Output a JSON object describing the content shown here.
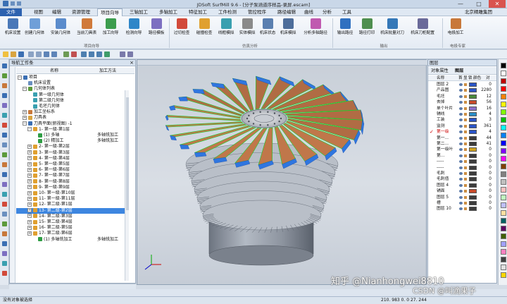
{
  "window": {
    "title": "JDSoft SurfMill 9.6 - [分子泵涵道序样品-录屏.escam]",
    "min": "—",
    "restore": "□",
    "close": "✕"
  },
  "menu": {
    "items": [
      "文件",
      "视图",
      "编辑",
      "资源管理",
      "项目向导",
      "三轴加工",
      "多轴加工",
      "特征加工",
      "工件检测",
      "管控程序",
      "路径编辑",
      "曲线",
      "分析",
      "工具"
    ],
    "right": "北京精雕集团"
  },
  "ribbon": {
    "buttons": [
      "机床设置",
      "创建几何体",
      "安装几何体",
      "当前刀具表",
      "加工向导",
      "检测向导",
      "路径模板",
      "过切检查",
      "碰撞检查",
      "线框模拟",
      "实体模拟",
      "机床状态",
      "机床模拟",
      "分析多轴路径",
      "输出路径",
      "路径打印",
      "机床批量对刀",
      "机床刀柜配置",
      "电极加工"
    ],
    "groups": [
      "项目向导",
      "仿真分析",
      "输出",
      "电极专家"
    ]
  },
  "nav_panel": {
    "title": "导航工作条",
    "columns": [
      "名称",
      "加工方法"
    ],
    "rows": [
      {
        "label": "项目",
        "method": ""
      },
      {
        "label": "机床设置",
        "method": ""
      },
      {
        "label": "几何体列表",
        "method": ""
      },
      {
        "label": "第一级几何体",
        "method": ""
      },
      {
        "label": "第二级几何体",
        "method": ""
      },
      {
        "label": "毛坯几何体",
        "method": ""
      },
      {
        "label": "加工坐标系",
        "method": ""
      },
      {
        "label": "刀具表",
        "method": ""
      },
      {
        "label": "刀具平面(俯视图) -1",
        "method": ""
      },
      {
        "label": "1- 第一级-第1层",
        "method": ""
      },
      {
        "label": "(1) 多轴",
        "method": "多轴铣加工"
      },
      {
        "label": "(2) 精加工",
        "method": "多轴铣加工"
      },
      {
        "label": "2- 第一级-第2层",
        "method": ""
      },
      {
        "label": "3- 第一级-第3层",
        "method": ""
      },
      {
        "label": "4- 第一级-第4层",
        "method": ""
      },
      {
        "label": "5- 第一级-第5层",
        "method": ""
      },
      {
        "label": "6- 第一级-第6层",
        "method": ""
      },
      {
        "label": "7- 第一级-第7层",
        "method": ""
      },
      {
        "label": "8- 第一级-第8层",
        "method": ""
      },
      {
        "label": "9- 第一级-第9层",
        "method": ""
      },
      {
        "label": "10- 第一级-第10层",
        "method": ""
      },
      {
        "label": "11- 第一级-第11层",
        "method": ""
      },
      {
        "label": "12- 第二级-第1层",
        "method": ""
      },
      {
        "label": "13- 第二级-第2层",
        "method": ""
      },
      {
        "label": "14- 第二级-第3层",
        "method": ""
      },
      {
        "label": "15- 第二级-第4层",
        "method": ""
      },
      {
        "label": "16- 第二级-第5层",
        "method": ""
      },
      {
        "label": "17- 第二级-第6层",
        "method": ""
      },
      {
        "label": "(1) 多轴铣加工",
        "method": "多轴铣加工"
      }
    ],
    "selected_index": 23
  },
  "layers_panel": {
    "title": "图层",
    "tabs": [
      "对象属性",
      "图层"
    ],
    "header": [
      "名称",
      "首",
      "显",
      "锁",
      "颜色",
      "对"
    ],
    "rows": [
      {
        "name": "图层 2",
        "count": "0",
        "color": "#2b55c8",
        "red": false
      },
      {
        "name": "产品图",
        "count": "2280",
        "color": "#2b55c8",
        "red": false
      },
      {
        "name": "毛坯",
        "count": "12",
        "color": "#4a8a3c",
        "red": false
      },
      {
        "name": "去掉",
        "count": "56",
        "color": "#c84b2b",
        "red": false
      },
      {
        "name": "单个叶片",
        "count": "16",
        "color": "#8c6fc9",
        "red": false
      },
      {
        "name": "辅线",
        "count": "4",
        "color": "#2b8fc8",
        "red": false
      },
      {
        "name": "工装",
        "count": "3",
        "color": "#2b55c8",
        "red": false
      },
      {
        "name": "监测",
        "count": "361",
        "color": "#2b55c8",
        "red": false
      },
      {
        "name": "第一级",
        "count": "4",
        "color": "#2b55c8",
        "red": true
      },
      {
        "name": "第一...",
        "count": "44",
        "color": "#3c3c3c",
        "red": false
      },
      {
        "name": "第二...",
        "count": "41",
        "color": "#3c3c3c",
        "red": false
      },
      {
        "name": "第一级叶",
        "count": "0",
        "color": "#cfa21e",
        "red": false
      },
      {
        "name": "第...",
        "count": "0",
        "color": "#3c3c3c",
        "red": false
      },
      {
        "name": "-----",
        "count": "0",
        "color": "#3c3c3c",
        "red": false
      },
      {
        "name": "-----",
        "count": "0",
        "color": "#3c3c3c",
        "red": false
      },
      {
        "name": "毛刺",
        "count": "0",
        "color": "#3c3c3c",
        "red": false
      },
      {
        "name": "毛刺值",
        "count": "0",
        "color": "#3c3c3c",
        "red": false
      },
      {
        "name": "图层 4",
        "count": "0",
        "color": "#3c3c3c",
        "red": false
      },
      {
        "name": "铺面",
        "count": "0",
        "color": "#c84b2b",
        "red": false
      },
      {
        "name": "图层 5",
        "count": "0",
        "color": "#3c3c3c",
        "red": false
      },
      {
        "name": "槽",
        "count": "0",
        "color": "#3c3c3c",
        "red": false
      },
      {
        "name": "图层 10",
        "count": "0",
        "color": "#3c3c3c",
        "red": false
      }
    ]
  },
  "palette": [
    "#000000",
    "#ffffff",
    "#c00000",
    "#ff0000",
    "#ff8000",
    "#ffff00",
    "#80ff00",
    "#00c000",
    "#00ffff",
    "#0080ff",
    "#0000ff",
    "#8000ff",
    "#ff00ff",
    "#804000",
    "#808080",
    "#c0c0c0",
    "#ffc0c0",
    "#c0ffc0",
    "#c0c0ff",
    "#ffe0a0",
    "#006060",
    "#600060",
    "#406000",
    "#a0a0ff",
    "#ff80c0",
    "#404040",
    "#e0e0e0",
    "#ffd700"
  ],
  "status": {
    "left": "没有对象被选择",
    "coord": "210. 983  0. 0  27. 244"
  },
  "watermark": {
    "zhihu": "知乎 @Nianhongwei8810",
    "csdn": "CSDN @叫滴果子"
  },
  "colors": {
    "accent": "#2d62b0",
    "selected": "#3d86e0",
    "copper": "#c0774a",
    "blade_edge": "#2f76e0",
    "toolpath": "#18d22b"
  }
}
